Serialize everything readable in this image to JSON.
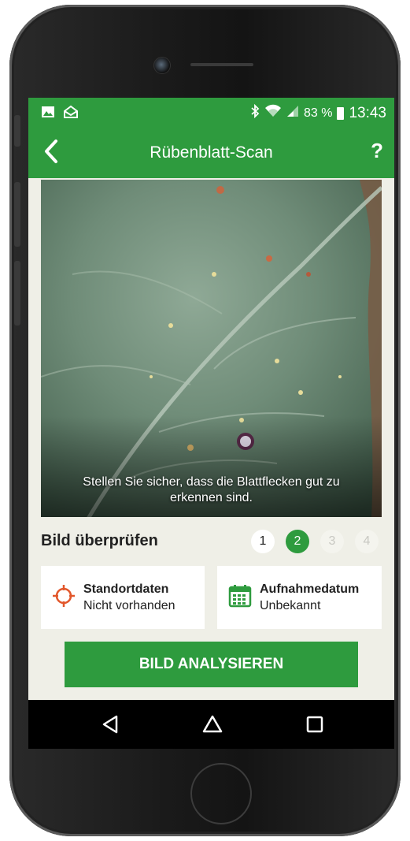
{
  "status_bar": {
    "battery": "83 %",
    "time": "13:43",
    "icons": [
      "image-notification-icon",
      "mail-notification-icon",
      "bluetooth-icon",
      "wifi-icon",
      "signal-icon",
      "battery-icon"
    ]
  },
  "app_bar": {
    "title": "Rübenblatt-Scan",
    "back_icon": "back-arrow-icon",
    "help_label": "?"
  },
  "photo": {
    "caption": "Stellen Sie sicher, dass die Blattflecken gut zu erkennen sind."
  },
  "review": {
    "title": "Bild überprüfen",
    "steps": [
      "1",
      "2",
      "3",
      "4"
    ],
    "current_step": 2
  },
  "location_card": {
    "icon": "location-crosshair-icon",
    "title": "Standortdaten",
    "value": "Nicht vorhanden"
  },
  "date_card": {
    "icon": "calendar-icon",
    "title": "Aufnahmedatum",
    "value": "Unbekannt"
  },
  "analyze_button": {
    "label": "BILD ANALYSIEREN"
  },
  "nav_bar": {
    "icons": [
      "back-triangle-icon",
      "home-icon",
      "recents-icon"
    ]
  },
  "colors": {
    "primary_green": "#2e9b3e",
    "location_icon": "#e2572b",
    "background": "#efefe7"
  }
}
